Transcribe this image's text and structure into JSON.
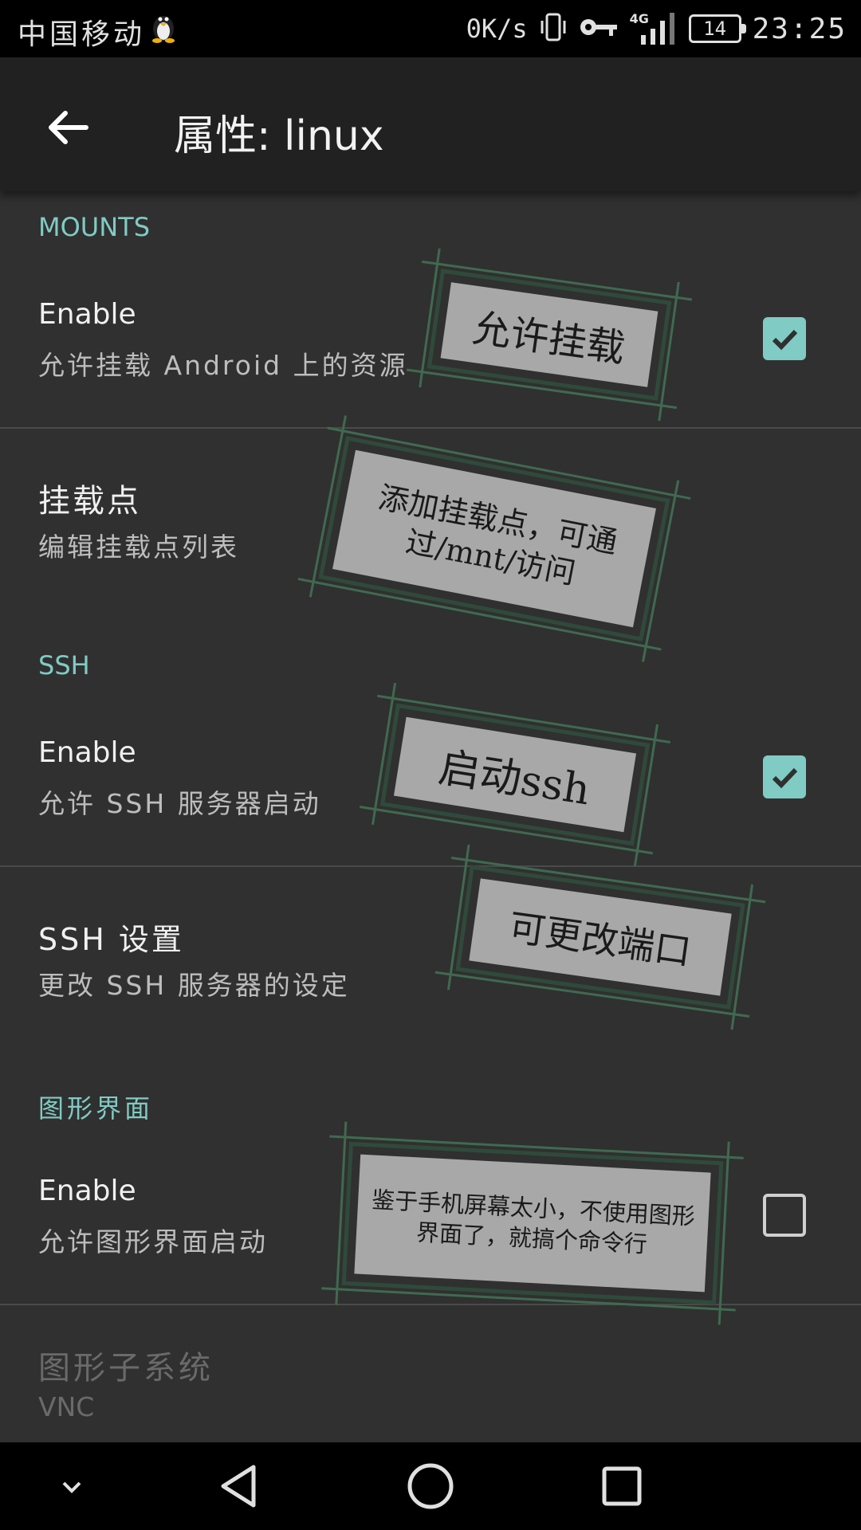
{
  "status_bar": {
    "carrier": "中国移动",
    "net_speed": "0K/s",
    "network": "4G",
    "battery": "14",
    "time": "23:25"
  },
  "app_bar": {
    "title": "属性: linux"
  },
  "sections": {
    "mounts": {
      "header": "MOUNTS",
      "enable": {
        "title": "Enable",
        "summary": "允许挂载 Android 上的资源",
        "checked": true
      },
      "mount_points": {
        "title": "挂载点",
        "summary": "编辑挂载点列表"
      }
    },
    "ssh": {
      "header": "SSH",
      "enable": {
        "title": "Enable",
        "summary": "允许 SSH 服务器启动",
        "checked": true
      },
      "settings": {
        "title": "SSH 设置",
        "summary": "更改 SSH 服务器的设定"
      }
    },
    "gui": {
      "header": "图形界面",
      "enable": {
        "title": "Enable",
        "summary": "允许图形界面启动",
        "checked": false
      },
      "subsystem": {
        "title": "图形子系统",
        "summary": "VNC"
      }
    }
  },
  "annotations": {
    "mount_enable": "允许挂载",
    "mount_points": "添加挂载点，可通过/mnt/访问",
    "ssh_enable": "启动ssh",
    "ssh_settings": "可更改端口",
    "gui_enable": "鉴于手机屏幕太小，不使用图形界面了，就搞个命令行"
  },
  "colors": {
    "accent": "#80cbc4",
    "background": "#303030",
    "app_bar": "#212121"
  },
  "icons": {
    "back": "arrow-left-icon",
    "nav_collapse": "chevron-down-icon",
    "nav_back": "triangle-back-icon",
    "nav_home": "circle-home-icon",
    "nav_recents": "square-recents-icon"
  }
}
